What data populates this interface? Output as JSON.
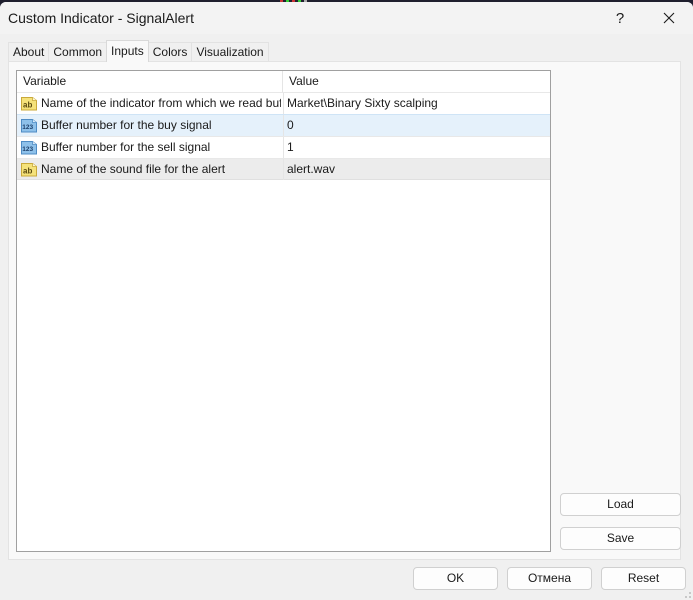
{
  "window": {
    "title": "Custom Indicator - SignalAlert",
    "help_label": "?",
    "close_icon": "close-icon"
  },
  "tabs": [
    {
      "label": "About",
      "active": false
    },
    {
      "label": "Common",
      "active": false
    },
    {
      "label": "Inputs",
      "active": true
    },
    {
      "label": "Colors",
      "active": false
    },
    {
      "label": "Visualization",
      "active": false
    }
  ],
  "inputs_table": {
    "columns": [
      "Variable",
      "Value"
    ],
    "rows": [
      {
        "icon": "string-type-icon",
        "icon_text": "ab",
        "variable": "Name of the indicator from which we read buf...",
        "value": "Market\\Binary Sixty scalping",
        "state": "normal"
      },
      {
        "icon": "integer-type-icon",
        "icon_text": "123",
        "variable": "Buffer number for the buy signal",
        "value": "0",
        "state": "selected"
      },
      {
        "icon": "integer-type-icon",
        "icon_text": "123",
        "variable": "Buffer number for the sell signal",
        "value": "1",
        "state": "normal"
      },
      {
        "icon": "string-type-icon",
        "icon_text": "ab",
        "variable": "Name of the sound file for the alert",
        "value": "alert.wav",
        "state": "hover"
      }
    ]
  },
  "side_buttons": {
    "load_label": "Load",
    "save_label": "Save"
  },
  "footer_buttons": {
    "ok_label": "OK",
    "cancel_label": "Отмена",
    "reset_label": "Reset"
  },
  "colors": {
    "selected_row": "#e5f1fb",
    "hover_row": "#ececec",
    "string_icon": "#f5e27a",
    "integer_icon": "#8ec1ea"
  }
}
